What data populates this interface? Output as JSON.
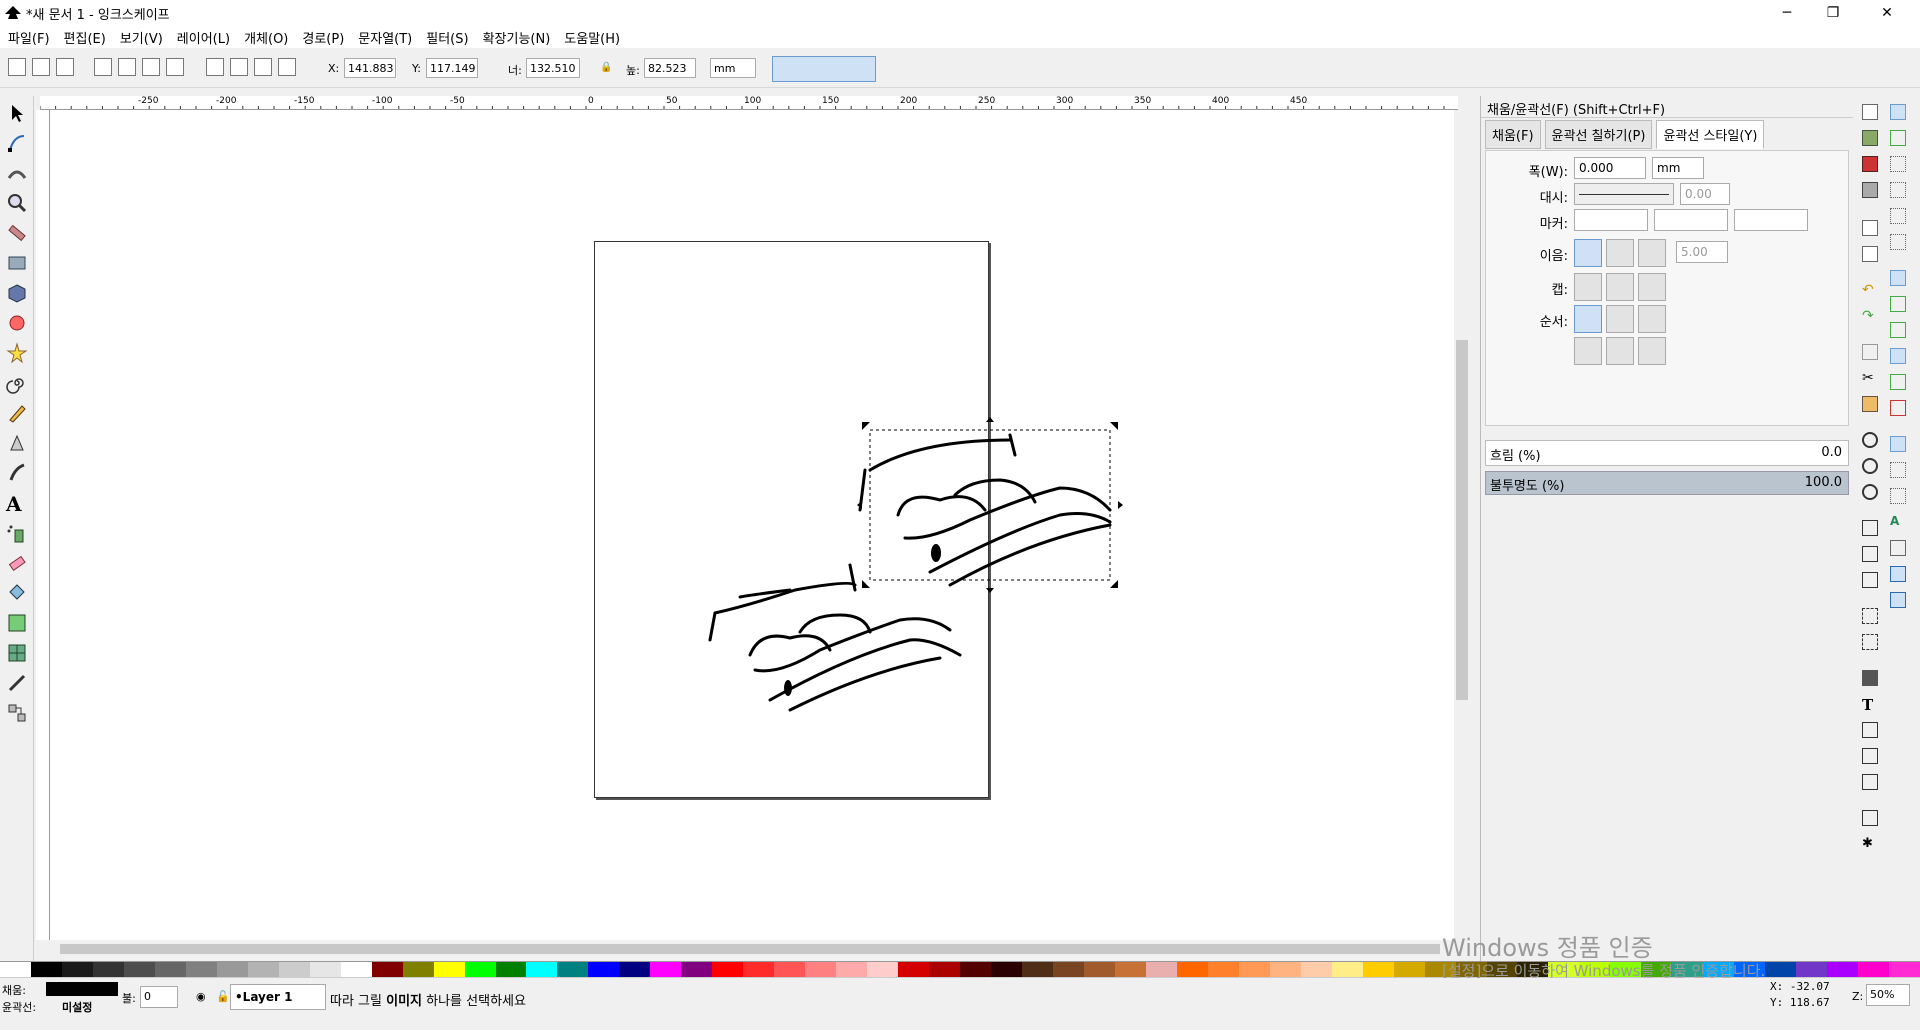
{
  "window": {
    "title": "*새 문서 1 - 잉크스케이프",
    "min": "─",
    "max": "❐",
    "close": "✕"
  },
  "menu": [
    "파일(F)",
    "편집(E)",
    "보기(V)",
    "레이어(L)",
    "개체(O)",
    "경로(P)",
    "문자열(T)",
    "필터(S)",
    "확장기능(N)",
    "도움말(H)"
  ],
  "toolbar": {
    "x_label": "X:",
    "x_value": "141.883",
    "y_label": "Y:",
    "y_value": "117.149",
    "w_label": "너:",
    "w_value": "132.510",
    "h_label": "높:",
    "h_value": "82.523",
    "unit": "mm"
  },
  "ruler": {
    "ticks": [
      "-250",
      "-200",
      "-150",
      "-100",
      "-50",
      "0",
      "50",
      "100",
      "150",
      "200",
      "250",
      "300",
      "350",
      "400",
      "450"
    ]
  },
  "panel": {
    "title": "채움/윤곽선(F) (Shift+Ctrl+F)",
    "tabs": [
      "채움(F)",
      "윤곽선 칠하기(P)",
      "윤곽선 스타일(Y)"
    ],
    "width_label": "폭(W):",
    "width_value": "0.000",
    "width_unit": "mm",
    "dash_label": "대시:",
    "dash_value": "0.00",
    "marker_label": "마커:",
    "join_label": "이음:",
    "join_value": "5.00",
    "cap_label": "캡:",
    "order_label": "순서:",
    "blur_label": "흐림 (%)",
    "blur_value": "0.0",
    "opacity_label": "불투명도 (%)",
    "opacity_value": "100.0"
  },
  "status": {
    "fill_label": "채움:",
    "stroke_label": "윤곽선:",
    "stroke_value": "미설정",
    "opacity_label": "불:",
    "opacity_value": "0",
    "layer": "•Layer 1",
    "message_a": "따라 그릴 ",
    "message_b": "이미지",
    "message_c": " 하나를 선택하세요",
    "coord_x": "X: -32.07",
    "coord_y": "Y: 118.67",
    "zoom_label": "Z:",
    "zoom_value": "50%"
  },
  "watermark": {
    "line1": "Windows 정품 인증",
    "line2": "[설정]으로 이동하여 Windows를 정품 인증합니다."
  },
  "colors": {
    "selection": "#000",
    "palette_accent": "#ff0000"
  }
}
